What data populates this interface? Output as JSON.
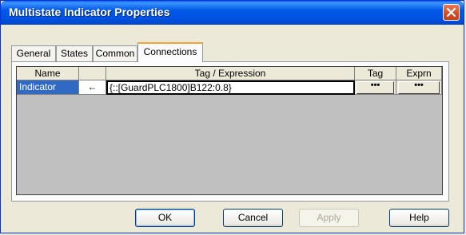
{
  "window": {
    "title": "Multistate Indicator Properties"
  },
  "tabs": [
    {
      "label": "General"
    },
    {
      "label": "States"
    },
    {
      "label": "Common"
    },
    {
      "label": "Connections",
      "active": true
    }
  ],
  "grid": {
    "columns": [
      "Name",
      "",
      "Tag / Expression",
      "Tag",
      "Exprn"
    ],
    "rows": [
      {
        "name": "Indicator",
        "direction": "←",
        "expression": "{::[GuardPLC1800]B122:0.8}",
        "tag_button": "•••",
        "exprn_button": "•••"
      }
    ]
  },
  "buttons": {
    "ok": "OK",
    "cancel": "Cancel",
    "apply": "Apply",
    "help": "Help"
  },
  "colors": {
    "titlebar": "#0054e3",
    "selection": "#316ac5",
    "close": "#d6491f"
  },
  "icons": {
    "close": "close-x-icon"
  }
}
